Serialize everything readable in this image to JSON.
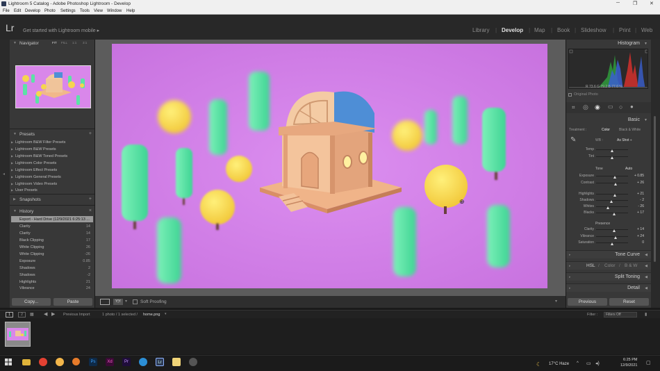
{
  "window": {
    "title": "Lightroom 5 Catalog - Adobe Photoshop Lightroom - Develop"
  },
  "menu": [
    "File",
    "Edit",
    "Develop",
    "Photo",
    "Settings",
    "Tools",
    "View",
    "Window",
    "Help"
  ],
  "identity": {
    "logo": "Lr",
    "mobile_prompt": "Get started with Lightroom mobile ▸"
  },
  "modules": [
    "Library",
    "Develop",
    "Map",
    "Book",
    "Slideshow",
    "Print",
    "Web"
  ],
  "left": {
    "navigator": {
      "title": "Navigator",
      "zooms": [
        "FIT",
        "FILL",
        "1:1",
        "3:1"
      ]
    },
    "presets": {
      "title": "Presets",
      "items": [
        "Lightroom B&W Filter Presets",
        "Lightroom B&W Presets",
        "Lightroom B&W Toned Presets",
        "Lightroom Color Presets",
        "Lightroom Effect Presets",
        "Lightroom General Presets",
        "Lightroom Video Presets",
        "User Presets"
      ]
    },
    "snapshots": {
      "title": "Snapshots"
    },
    "history": {
      "title": "History",
      "items": [
        {
          "label": "Export - Hard Drive (12/9/2021 6:25:13 ...",
          "value": ""
        },
        {
          "label": "Clarity",
          "value": "14"
        },
        {
          "label": "Clarity",
          "value": "14"
        },
        {
          "label": "Black Clipping",
          "value": "17"
        },
        {
          "label": "White Clipping",
          "value": "26"
        },
        {
          "label": "White Clipping",
          "value": "-26"
        },
        {
          "label": "Exposure",
          "value": "0.85"
        },
        {
          "label": "Shadows",
          "value": "2"
        },
        {
          "label": "Shadows",
          "value": "-2"
        },
        {
          "label": "Highlights",
          "value": "21"
        },
        {
          "label": "Vibrance",
          "value": "24"
        }
      ]
    },
    "copy_label": "Copy...",
    "paste_label": "Paste"
  },
  "right": {
    "histogram": {
      "title": "Histogram",
      "readout": "R  73.6  G  79.2  B  77.6  %",
      "original_label": "Original Photo"
    },
    "basic": {
      "title": "Basic",
      "treatment_label": "Treatment :",
      "treatment_color": "Color",
      "treatment_bw": "Black & White",
      "wb_label": "WB :",
      "wb_value": "As Shot ÷",
      "tone_label": "Tone",
      "auto_label": "Auto",
      "presence_label": "Presence",
      "sliders": [
        {
          "label": "Temp",
          "value": "",
          "pos": 0.5
        },
        {
          "label": "Tint",
          "value": "",
          "pos": 0.5
        },
        {
          "label": "Exposure",
          "value": "+ 0.85",
          "pos": 0.59
        },
        {
          "label": "Contrast",
          "value": "+ 26",
          "pos": 0.63
        },
        {
          "label": "Highlights",
          "value": "+ 21",
          "pos": 0.6
        },
        {
          "label": "Shadows",
          "value": "- 2",
          "pos": 0.49
        },
        {
          "label": "Whites",
          "value": "- 26",
          "pos": 0.37
        },
        {
          "label": "Blacks",
          "value": "+ 17",
          "pos": 0.58
        },
        {
          "label": "Clarity",
          "value": "+ 14",
          "pos": 0.57
        },
        {
          "label": "Vibrance",
          "value": "+ 24",
          "pos": 0.62
        },
        {
          "label": "Saturation",
          "value": "0",
          "pos": 0.5
        }
      ]
    },
    "tone_curve": "Tone Curve",
    "hsl": {
      "a": "HSL",
      "b": "Color",
      "c": "B & W"
    },
    "split_toning": "Split Toning",
    "detail": "Detail",
    "previous_label": "Previous",
    "reset_label": "Reset"
  },
  "toolbar": {
    "soft_proofing": "Soft Proofing"
  },
  "filmstrip_bar": {
    "pages": [
      "1",
      "2"
    ],
    "source": "Previous Import",
    "count": "1 photo / 1 selected /",
    "filename": "home.png",
    "filter_label": "Filter :",
    "filter_value": "Filters Off"
  },
  "taskbar": {
    "weather": "17°C  Haze",
    "time": "6:25 PM",
    "date": "12/9/2021"
  },
  "colors": {
    "accent_text": "#e2e2e2",
    "panel": "#383838",
    "photo_bg": "#cf7ee6",
    "tree_green": "#4fe0a0",
    "ball_yellow": "#f4d24a"
  }
}
